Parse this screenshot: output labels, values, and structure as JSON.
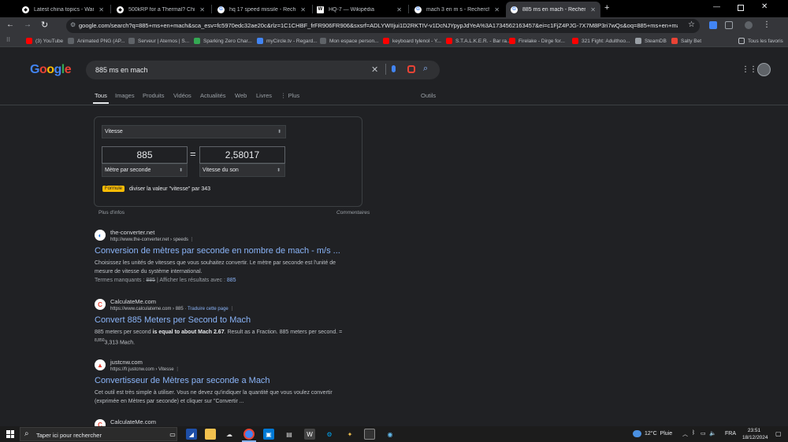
{
  "tabs": [
    {
      "title": "Latest china topics - War Thund",
      "active": false
    },
    {
      "title": "500kRP for a Thermal? China's",
      "active": false
    },
    {
      "title": "hq 17 speed missile - Recherch",
      "active": false
    },
    {
      "title": "HQ-7 — Wikipédia",
      "active": false
    },
    {
      "title": "mach 3 en m s - Recherche Go",
      "active": false
    },
    {
      "title": "885 ms en mach - Recherche Go",
      "active": true
    }
  ],
  "toolbar": {
    "url": "google.com/search?q=885+ms+en+mach&sca_esv=fc5970edc32ae20c&rlz=1C1CHBF_frFR906FR906&sxsrf=ADLYWIIjui1D2RKTIV-v1DcNJYpypJdYeA%3A1734562163457&ei=c1FjZ4PJG-7X7M8P3ri7wQs&oq=885+ms+en+mac&gs_lp=Eg..."
  },
  "bookmarks": {
    "items": [
      {
        "label": "(3) YouTube",
        "color": "#ff0000"
      },
      {
        "label": "Animated PNG (AP...",
        "color": "#9aa0a6"
      },
      {
        "label": "Serveur | Aternos | S...",
        "color": "#9aa0a6"
      },
      {
        "label": "Sparking Zero Char...",
        "color": "#34a853"
      },
      {
        "label": "myCircle.tv - Regard...",
        "color": "#4285f4"
      },
      {
        "label": "Mon espace person...",
        "color": "#9aa0a6"
      },
      {
        "label": "keyboard tylenol - Y...",
        "color": "#ff0000"
      },
      {
        "label": "S.T.A.L.K.E.R. - Bar ra...",
        "color": "#ff0000"
      },
      {
        "label": "Firelake - Dirge for...",
        "color": "#ff0000"
      },
      {
        "label": "321 Fight: Adulthoo...",
        "color": "#ff0000"
      },
      {
        "label": "SteamDB",
        "color": "#9aa0a6"
      },
      {
        "label": "Salty Bet",
        "color": "#ea4335"
      }
    ],
    "all_label": "Tous les favoris"
  },
  "search": {
    "query": "885 ms en mach",
    "tabs": [
      "Tous",
      "Images",
      "Produits",
      "Vidéos",
      "Actualités",
      "Web",
      "Livres",
      "Plus"
    ],
    "tools": "Outils"
  },
  "converter": {
    "category": "Vitesse",
    "from_value": "885",
    "equals": "=",
    "to_value": "2,58017",
    "from_unit": "Mètre par seconde",
    "to_unit": "Vitesse du son",
    "formula_badge": "Formule",
    "formula_text": "diviser la valeur \"vitesse\" par 343",
    "more_info": "Plus d'infos",
    "comments": "Commentaires"
  },
  "results": [
    {
      "site": "the-converter.net",
      "url": "http://www.the-converter.net › speeds",
      "title": "Conversion de mètres par seconde en nombre de mach - m/s ...",
      "snippet": "Choisissez les unités de vitesses que vous souhaitez convertir. Le mètre par seconde est l'unité de mesure de vitesse du système international.",
      "missing_label": "Termes manquants :",
      "missing_term": "885",
      "missing_sep": "| Afficher les résultats avec :",
      "missing_link": "885"
    },
    {
      "site": "CalculateMe.com",
      "url": "https://www.calculateme.com › 885",
      "translate": "Traduire cette page",
      "title": "Convert 885 Meters per Second to Mach",
      "snippet_a": "885 meters per second",
      "snippet_b": "is equal to about Mach 2.67",
      "snippet_c": ". Result as a Fraction. 885 meters per second. =",
      "snippet_sup": "8,850",
      "snippet_d": "3,313 Mach."
    },
    {
      "site": "justcnw.com",
      "url": "https://fr.justcnw.com › Vitesse",
      "title": "Convertisseur de Mètres par seconde a Mach",
      "snippet": "Cet outil est très simple à utiliser. Vous ne devez qu'indiquer la quantité que vous voulez convertir (exprimée en Mètres par seconde) et cliquer sur \"Convertir ..."
    },
    {
      "site": "CalculateMe.com"
    }
  ],
  "taskbar": {
    "search_placeholder": "Taper ici pour rechercher",
    "weather": "12°C  Pluie",
    "lang": "FRA",
    "time": "23:51",
    "date": "18/12/2024"
  }
}
